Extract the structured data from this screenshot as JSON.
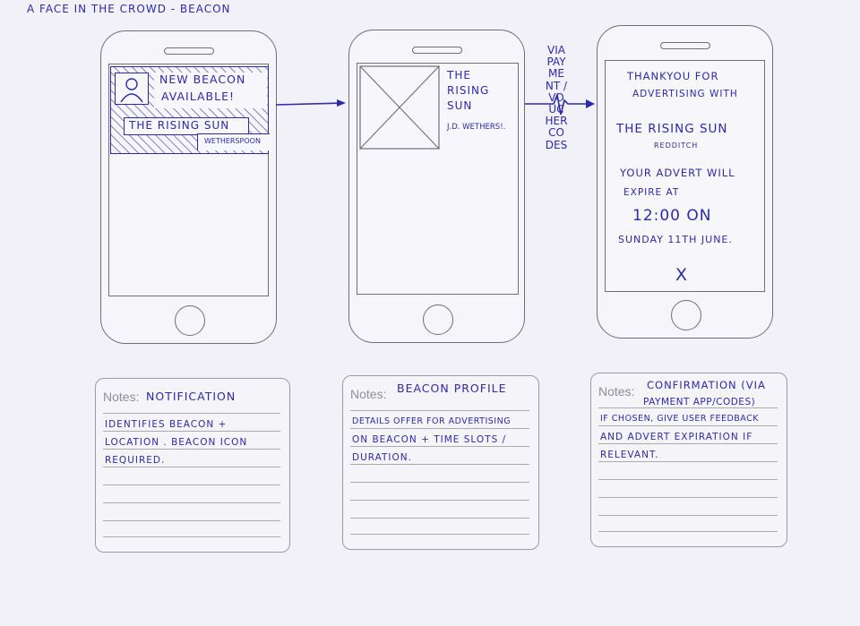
{
  "sheet_title": "A FACE IN THE CROWD - BEACON",
  "screens": [
    {
      "notification_title_line1": "NEW BEACON",
      "notification_title_line2": "AVAILABLE!",
      "venue": "THE RISING SUN",
      "operator": "WETHERSPOON"
    },
    {
      "venue_line1": "THE",
      "venue_line2": "RISING",
      "venue_line3": "SUN",
      "operator": "J.D. WETHERS!."
    },
    {
      "lines": [
        "THANKYOU FOR",
        "ADVERTISING WITH",
        "THE RISING SUN",
        "REDDITCH",
        "YOUR ADVERT WILL",
        "EXPIRE AT",
        "12:00 ON",
        "SUNDAY 11TH JUNE."
      ],
      "close_glyph": "X"
    }
  ],
  "connector_label": "VIA PAYMENT / VOUCHER CODES",
  "notes": [
    {
      "label": "Notes:",
      "heading": "NOTIFICATION",
      "lines": [
        "IDENTIFIES BEACON +",
        "LOCATION . BEACON ICON",
        "REQUIRED."
      ]
    },
    {
      "label": "Notes:",
      "heading": "BEACON PROFILE",
      "lines": [
        "DETAILS OFFER FOR ADVERTISING",
        "ON BEACON + TIME SLOTS /",
        "DURATION."
      ]
    },
    {
      "label": "Notes:",
      "heading": "CONFIRMATION (VIA",
      "heading2": "PAYMENT APP/CODES)",
      "lines": [
        "IF CHOSEN, GIVE USER FEEDBACK",
        "AND ADVERT EXPIRATION IF",
        "RELEVANT."
      ]
    }
  ],
  "colors": {
    "ink": "#2d2aa8",
    "wireframe": "#6e6e78",
    "paper": "#f3f1f8"
  }
}
